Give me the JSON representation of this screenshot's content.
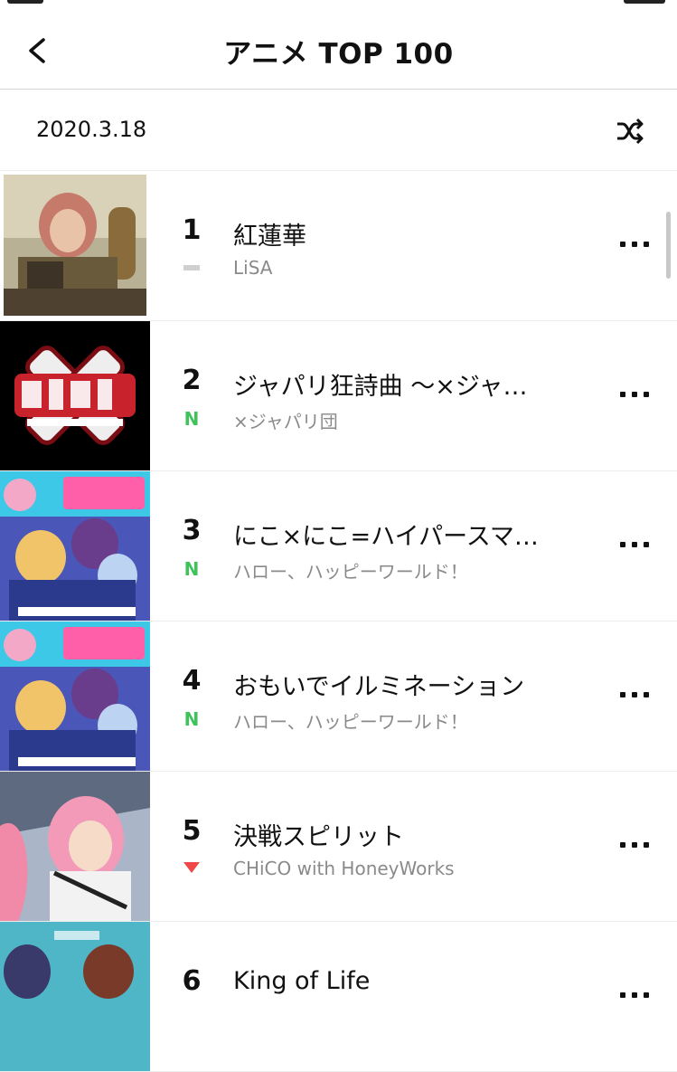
{
  "header": {
    "title": "アニメ TOP 100"
  },
  "date": "2020.3.18",
  "icons": {
    "back": "chevron-left-icon",
    "shuffle": "shuffle-icon",
    "more": "more-dots-icon"
  },
  "colors": {
    "new": "#3ec35a",
    "down": "#f04848",
    "same": "#cfcfcf"
  },
  "tracks": [
    {
      "rank": "1",
      "title": "紅蓮華",
      "artist": "LiSA",
      "change": "same"
    },
    {
      "rank": "2",
      "title": "ジャパリ狂詩曲 〜×ジャ…",
      "artist": "×ジャパリ団",
      "change": "new",
      "change_label": "N"
    },
    {
      "rank": "3",
      "title": "にこ×にこ=ハイパースマ…",
      "artist": "ハロー、ハッピーワールド！",
      "change": "new",
      "change_label": "N"
    },
    {
      "rank": "4",
      "title": "おもいでイルミネーション",
      "artist": "ハロー、ハッピーワールド！",
      "change": "new",
      "change_label": "N"
    },
    {
      "rank": "5",
      "title": "決戦スピリット",
      "artist": "CHiCO with HoneyWorks",
      "change": "down"
    },
    {
      "rank": "6",
      "title": "King of Life",
      "artist": "",
      "change": ""
    }
  ]
}
